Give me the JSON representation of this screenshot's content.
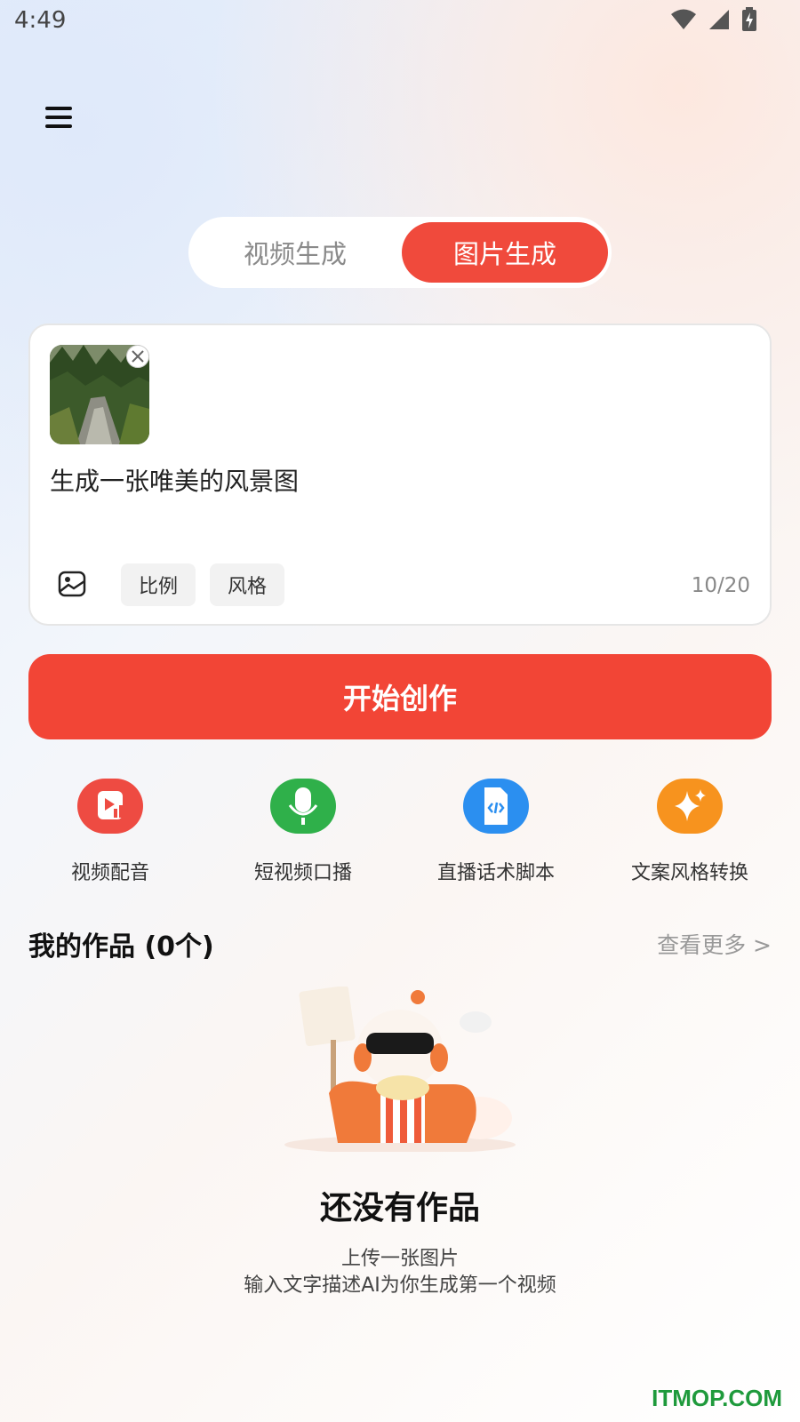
{
  "status_bar": {
    "time": "4:49"
  },
  "header": {
    "menu_icon": "hamburger-menu-icon"
  },
  "mode_tabs": {
    "video_label": "视频生成",
    "image_label": "图片生成",
    "selected": "image"
  },
  "input_card": {
    "prompt_text": "生成一张唯美的风景图",
    "ratio_label": "比例",
    "style_label": "风格",
    "char_count": "10/20"
  },
  "start_button": {
    "label": "开始创作"
  },
  "tools": [
    {
      "label": "视频配音",
      "icon": "video-dubbing-icon"
    },
    {
      "label": "短视频口播",
      "icon": "microphone-icon"
    },
    {
      "label": "直播话术脚本",
      "icon": "script-file-icon"
    },
    {
      "label": "文案风格转换",
      "icon": "sparkle-icon"
    }
  ],
  "works": {
    "title": "我的作品 (0个)",
    "more_label": "查看更多 >"
  },
  "empty_state": {
    "title": "还没有作品",
    "line1": "上传一张图片",
    "line2": "输入文字描述AI为你生成第一个视频"
  },
  "watermark": "ITMOP.COM",
  "colors": {
    "accent": "#f04a3c",
    "green": "#2fb04a",
    "blue": "#2b8ff0",
    "orange": "#f7931e"
  }
}
